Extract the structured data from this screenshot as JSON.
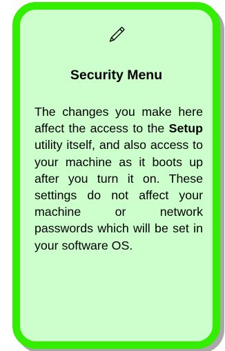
{
  "note": {
    "icon": "pen-icon",
    "title": "Security Menu",
    "body_before": "The changes you make here affect the access to the ",
    "body_bold": "Setup",
    "body_after": " utility itself, and also access to your machine as it boots up after you turn it on. These settings do not affect your machine or network passwords which will be set in your software OS."
  },
  "colors": {
    "card_fill": "#ccffcc",
    "card_border": "#33ee00",
    "card_shadow": "#a9a9a9",
    "text": "#000000"
  }
}
